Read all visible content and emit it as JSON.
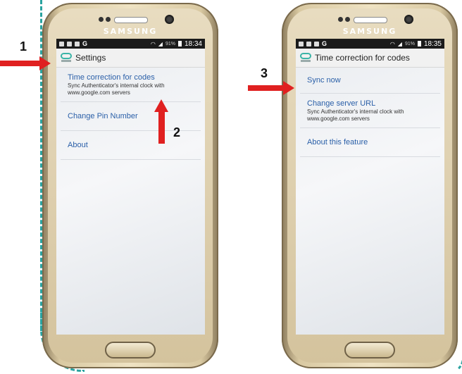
{
  "colors": {
    "dashed_line": "#2aa3a0",
    "arrow": "#e02020",
    "link_text": "#2a5fa8"
  },
  "brand": "SAMSUNG",
  "phone_left": {
    "status": {
      "battery": "91%",
      "time": "18:34"
    },
    "title": "Settings",
    "items": [
      {
        "title": "Time correction for codes",
        "subtitle": "Sync Authenticator's internal clock with www.google.com servers"
      },
      {
        "title": "Change Pin Number",
        "subtitle": ""
      },
      {
        "title": "About",
        "subtitle": ""
      }
    ]
  },
  "phone_right": {
    "status": {
      "battery": "91%",
      "time": "18:35"
    },
    "title": "Time correction for codes",
    "items": [
      {
        "title": "Sync now",
        "subtitle": ""
      },
      {
        "title": "Change server URL",
        "subtitle": "Sync Authenticator's internal clock with www.google.com servers"
      },
      {
        "title": "About this feature",
        "subtitle": ""
      }
    ]
  },
  "callouts": [
    "1",
    "2",
    "3"
  ]
}
